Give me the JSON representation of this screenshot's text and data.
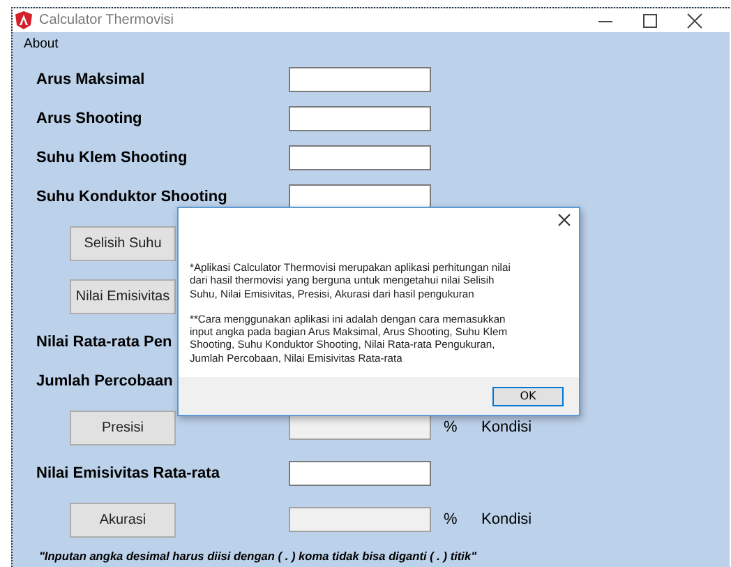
{
  "window": {
    "title": "Calculator Thermovisi"
  },
  "menu": [
    {
      "label": "About"
    }
  ],
  "form": {
    "rows": [
      {
        "kind": "field",
        "label": "Arus Maksimal"
      },
      {
        "kind": "field",
        "label": "Arus Shooting"
      },
      {
        "kind": "field",
        "label": "Suhu Klem Shooting"
      },
      {
        "kind": "field",
        "label": "Suhu Konduktor Shooting"
      },
      {
        "kind": "action",
        "button": "Selisih Suhu"
      },
      {
        "kind": "action",
        "button": "Nilai Emisivitas"
      },
      {
        "kind": "label",
        "label": "Nilai Rata-rata Pen"
      },
      {
        "kind": "label",
        "label": "Jumlah Percobaan"
      },
      {
        "kind": "result",
        "button": "Presisi",
        "unit": "%",
        "status": "Kondisi"
      },
      {
        "kind": "field",
        "label": "Nilai Emisivitas Rata-rata"
      },
      {
        "kind": "result",
        "button": "Akurasi",
        "unit": "%",
        "status": "Kondisi"
      }
    ],
    "note": "\"Inputan angka desimal harus diisi dengan ( . ) koma tidak bisa diganti ( . ) titik\""
  },
  "dialog": {
    "paragraphs": [
      [
        "*Aplikasi Calculator Thermovisi merupakan aplikasi perhitungan nilai",
        "dari hasil thermovisi yang berguna untuk mengetahui nilai Selisih",
        "Suhu, Nilai Emisivitas, Presisi, Akurasi dari hasil pengukuran"
      ],
      [
        "**Cara menggunakan aplikasi ini adalah dengan cara memasukkan",
        "input angka pada bagian Arus Maksimal, Arus Shooting, Suhu Klem",
        "Shooting, Suhu Konduktor Shooting, Nilai Rata-rata Pengukuran,",
        "Jumlah Percobaan, Nilai Emisivitas Rata-rata"
      ]
    ],
    "ok": "OK"
  }
}
